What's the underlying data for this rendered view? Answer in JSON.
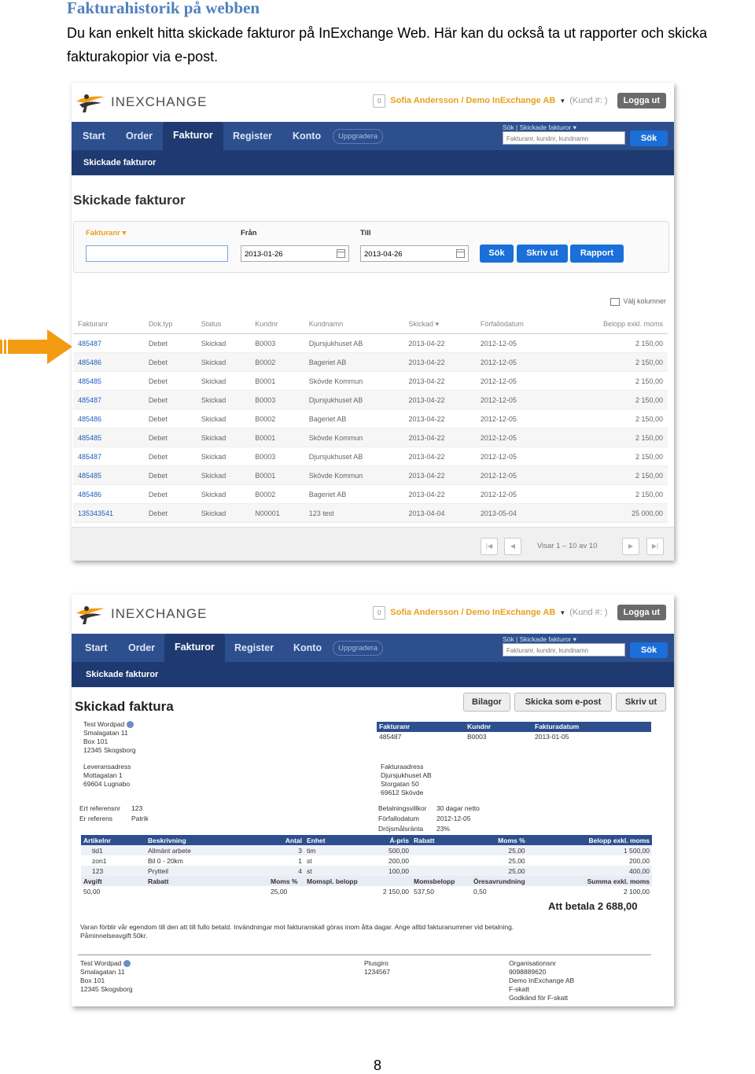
{
  "doc": {
    "title": "Fakturahistorik på webben",
    "intro": "Du kan enkelt hitta skickade fakturor på InExchange Web. Här kan du också ta ut rapporter och skicka fakturakopior via e-post.",
    "page_number": "8"
  },
  "colors": {
    "accent_orange": "#f39c12",
    "nav_blue": "#2d4f8e",
    "button_blue": "#1a6fd8"
  },
  "app": {
    "logo": "INEXCHANGE",
    "notifications": "0",
    "user": "Sofia Andersson / Demo InExchange AB",
    "customer_no": "(Kund #: )",
    "logout": "Logga ut",
    "nav": [
      "Start",
      "Order",
      "Fakturor",
      "Register",
      "Konto"
    ],
    "upgrade": "Uppgradera",
    "search_label": "Sök | Skickade fakturor ▾",
    "search_placeholder": "Fakturanr, kundnr, kundnamn",
    "search_button": "Sök",
    "subnav": "Skickade fakturor"
  },
  "shot1": {
    "title": "Skickade fakturor",
    "filter": {
      "field_label": "Fakturanr ▾",
      "from_label": "Från",
      "from_value": "2013-01-26",
      "to_label": "Till",
      "to_value": "2013-04-26",
      "search": "Sök",
      "print": "Skriv ut",
      "report": "Rapport"
    },
    "choose_columns": "Välj kolumner",
    "columns": [
      "Fakturanr",
      "Dok.typ",
      "Status",
      "Kundnr",
      "Kundnamn",
      "Skickad ▾",
      "Förfallodatum",
      "Belopp exkl. moms"
    ],
    "rows": [
      [
        "485487",
        "Debet",
        "Skickad",
        "B0003",
        "Djursjukhuset AB",
        "2013-04-22",
        "2012-12-05",
        "2 150,00"
      ],
      [
        "485486",
        "Debet",
        "Skickad",
        "B0002",
        "Bageriet AB",
        "2013-04-22",
        "2012-12-05",
        "2 150,00"
      ],
      [
        "485485",
        "Debet",
        "Skickad",
        "B0001",
        "Skövde Kommun",
        "2013-04-22",
        "2012-12-05",
        "2 150,00"
      ],
      [
        "485487",
        "Debet",
        "Skickad",
        "B0003",
        "Djursjukhuset AB",
        "2013-04-22",
        "2012-12-05",
        "2 150,00"
      ],
      [
        "485486",
        "Debet",
        "Skickad",
        "B0002",
        "Bageriet AB",
        "2013-04-22",
        "2012-12-05",
        "2 150,00"
      ],
      [
        "485485",
        "Debet",
        "Skickad",
        "B0001",
        "Skövde Kommun",
        "2013-04-22",
        "2012-12-05",
        "2 150,00"
      ],
      [
        "485487",
        "Debet",
        "Skickad",
        "B0003",
        "Djursjukhuset AB",
        "2013-04-22",
        "2012-12-05",
        "2 150,00"
      ],
      [
        "485485",
        "Debet",
        "Skickad",
        "B0001",
        "Skövde Kommun",
        "2013-04-22",
        "2012-12-05",
        "2 150,00"
      ],
      [
        "485486",
        "Debet",
        "Skickad",
        "B0002",
        "Bageriet AB",
        "2013-04-22",
        "2012-12-05",
        "2 150,00"
      ],
      [
        "135343541",
        "Debet",
        "Skickad",
        "N00001",
        "123 test",
        "2013-04-04",
        "2013-05-04",
        "25 000,00"
      ]
    ],
    "pager": "Visar 1 – 10 av 10"
  },
  "shot2": {
    "title": "Skickad faktura",
    "buttons": {
      "attachments": "Bilagor",
      "email": "Skicka som e-post",
      "print": "Skriv ut"
    },
    "sender": [
      "Test Wordpad",
      "Smalagatan 11",
      "Box 101",
      "12345 Skogsborg"
    ],
    "delivery_title": "Leveransadress",
    "delivery": [
      "Mottagatan 1",
      "69604 Lugnabo"
    ],
    "your_ref_label": "Ert referensnr",
    "your_ref": "123",
    "our_ref_label": "Er referens",
    "our_ref": "Patrik",
    "header_cols": [
      "Fakturanr",
      "Kundnr",
      "Fakturadatum"
    ],
    "header_vals": [
      "485487",
      "B0003",
      "2013-01-05"
    ],
    "billing_title": "Fakturaadress",
    "billing": [
      "Djursjukhuset AB",
      "Storgatan 50",
      "69612 Skövde"
    ],
    "terms_label": "Betalningsvillkor",
    "terms_value": "30 dagar netto",
    "due_label": "Förfallodatum",
    "due_value": "2012-12-05",
    "interest_label": "Dröjsmålsränta",
    "interest_value": "23%",
    "item_cols": [
      "Artikelnr",
      "Beskrivning",
      "Antal",
      "Enhet",
      "Á-pris",
      "Rabatt",
      "Moms %",
      "Belopp exkl. moms"
    ],
    "items": [
      [
        "tid1",
        "Allmänt arbete",
        "3",
        "tim",
        "500,00",
        "",
        "25,00",
        "1 500,00"
      ],
      [
        "zon1",
        "Bil 0 - 20km",
        "1",
        "st",
        "200,00",
        "",
        "25,00",
        "200,00"
      ],
      [
        "123",
        "Prytteil",
        "4",
        "st",
        "100,00",
        "",
        "25,00",
        "400,00"
      ]
    ],
    "sum_cols": [
      "Avgift",
      "Rabatt",
      "Moms %",
      "Momspl. belopp",
      "Momsbelopp",
      "Öresavrundning",
      "Summa exkl. moms"
    ],
    "sum_vals": [
      "50,00",
      "",
      "25,00",
      "2 150,00",
      "537,50",
      "0,50",
      "2 100,00"
    ],
    "to_pay": "Att betala 2 688,00",
    "terms_text": "Varan förblir vår egendom till den att till fullo betald. Invändningar mot fakturanskall göras inom åtta dagar. Ange alltid fakturanummer vid betalning. Påminnelseavgift 50kr.",
    "footer_sender": [
      "Test Wordpad",
      "Smalagatan 11",
      "Box 101",
      "12345 Skogsborg"
    ],
    "footer_giro": [
      "Plusgiro",
      "1234567"
    ],
    "footer_org": [
      "Organisationsnr",
      "9098889620",
      "Demo InExchange AB",
      "F-skatt",
      "Godkänd för F-skatt"
    ]
  }
}
